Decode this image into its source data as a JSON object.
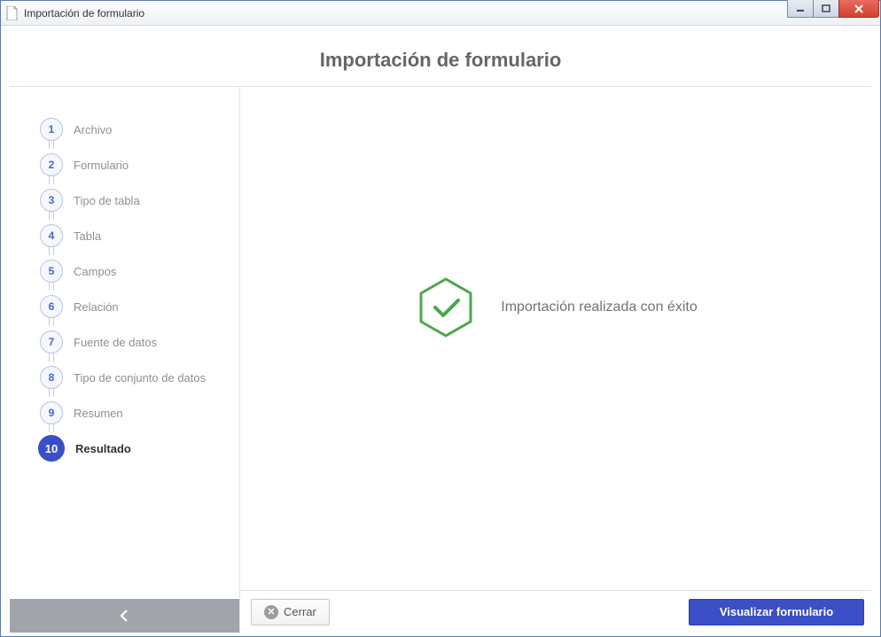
{
  "window": {
    "title": "Importación de formulario"
  },
  "page": {
    "title": "Importación de formulario"
  },
  "steps": [
    {
      "num": "1",
      "label": "Archivo"
    },
    {
      "num": "2",
      "label": "Formulario"
    },
    {
      "num": "3",
      "label": "Tipo de tabla"
    },
    {
      "num": "4",
      "label": "Tabla"
    },
    {
      "num": "5",
      "label": "Campos"
    },
    {
      "num": "6",
      "label": "Relación"
    },
    {
      "num": "7",
      "label": "Fuente de datos"
    },
    {
      "num": "8",
      "label": "Tipo de conjunto de datos"
    },
    {
      "num": "9",
      "label": "Resumen"
    },
    {
      "num": "10",
      "label": "Resultado"
    }
  ],
  "activeStepIndex": 9,
  "result": {
    "message": "Importación realizada con éxito"
  },
  "footer": {
    "close_label": "Cerrar",
    "primary_label": "Visualizar formulario"
  }
}
